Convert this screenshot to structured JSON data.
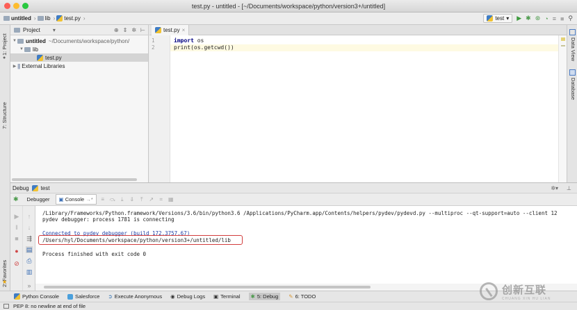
{
  "window": {
    "title": "test.py - untitled - [~/Documents/workspace/python/version3+/untitled]"
  },
  "nav": {
    "breadcrumb": [
      "untitled",
      "lib",
      "test.py"
    ],
    "run_config": "test"
  },
  "left_strip": {
    "project_label": "1: Project",
    "structure_label": "7: Structure",
    "favorites_label": "2: Favorites"
  },
  "right_strip": {
    "data_view_label": "Data View",
    "database_label": "Database"
  },
  "project_panel": {
    "header_label": "Project",
    "tree": [
      {
        "label": "untitled",
        "detail": "~/Documents/workspace/python/",
        "level": 0,
        "expanded": true
      },
      {
        "label": "lib",
        "detail": "",
        "level": 1,
        "expanded": true
      },
      {
        "label": "test.py",
        "detail": "",
        "level": 2,
        "selected": true
      },
      {
        "label": "External Libraries",
        "detail": "",
        "level": 0,
        "expanded": false
      }
    ]
  },
  "editor": {
    "tab_label": "test.py",
    "lines": [
      {
        "num": "1",
        "kw": "import",
        "rest": " os"
      },
      {
        "num": "2",
        "kw": "",
        "rest": "print(os.getcwd())"
      }
    ]
  },
  "debug": {
    "header_label": "Debug",
    "config_name": "test",
    "tabs": {
      "debugger": "Debugger",
      "console": "Console"
    },
    "console_lines": [
      "/Library/Frameworks/Python.framework/Versions/3.6/bin/python3.6 /Applications/PyCharm.app/Contents/helpers/pydev/pydevd.py --multiproc --qt-support=auto --client 12",
      "pydev debugger: process 1781 is connecting",
      "",
      "Connected to pydev debugger (build 172.3757.67)",
      "/Users/hyl/Documents/workspace/python/version3+/untitled/lib",
      "",
      "Process finished with exit code 0"
    ]
  },
  "bottom_tools": [
    {
      "label": "Python Console",
      "active": false
    },
    {
      "label": "Salesforce",
      "active": false
    },
    {
      "label": "Execute Anonymous",
      "active": false
    },
    {
      "label": "Debug Logs",
      "active": false
    },
    {
      "label": "Terminal",
      "active": false
    },
    {
      "label": "5: Debug",
      "active": true
    },
    {
      "label": "6: TODO",
      "active": false
    }
  ],
  "status": {
    "message": "PEP 8: no newline at end of file"
  },
  "watermark": {
    "cn": "创新互联",
    "en": "CHUANG XIN HU LIAN"
  },
  "colors": {
    "close": "#fc5f57",
    "minimize": "#fdbc2e",
    "zoom": "#28c840",
    "highlight_box": "#d23c3c",
    "keyword": "#000080"
  }
}
